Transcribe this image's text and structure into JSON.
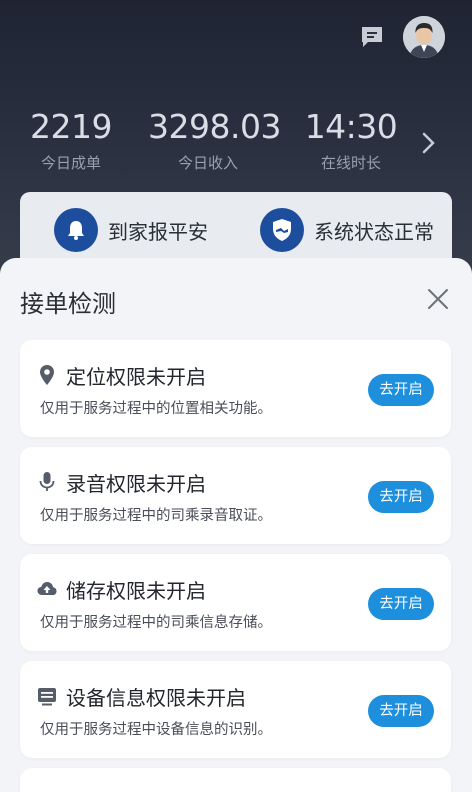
{
  "colors": {
    "accent": "#1d8fdd",
    "shield_blue": "#1d4e9e",
    "dark_bg": "#1f2433"
  },
  "header": {
    "message_icon": "message-icon",
    "avatar": "driver-avatar"
  },
  "stats": [
    {
      "value": "2219",
      "label": "今日成单"
    },
    {
      "value": "3298.03",
      "label": "今日收入"
    },
    {
      "value": "14:30",
      "label": "在线时长"
    }
  ],
  "quick_actions": [
    {
      "label": "到家报平安",
      "icon": "bell-icon"
    },
    {
      "label": "系统状态正常",
      "icon": "shield-icon"
    }
  ],
  "sheet": {
    "title": "接单检测",
    "items": [
      {
        "icon": "location-pin-icon",
        "title": "定位权限未开启",
        "desc": "仅用于服务过程中的位置相关功能。",
        "button": "去开启"
      },
      {
        "icon": "microphone-icon",
        "title": "录音权限未开启",
        "desc": "仅用于服务过程中的司乘录音取证。",
        "button": "去开启"
      },
      {
        "icon": "cloud-upload-icon",
        "title": "储存权限未开启",
        "desc": "仅用于服务过程中的司乘信息存储。",
        "button": "去开启"
      },
      {
        "icon": "device-info-icon",
        "title": "设备信息权限未开启",
        "desc": "仅用于服务过程中设备信息的识别。",
        "button": "去开启"
      }
    ]
  }
}
